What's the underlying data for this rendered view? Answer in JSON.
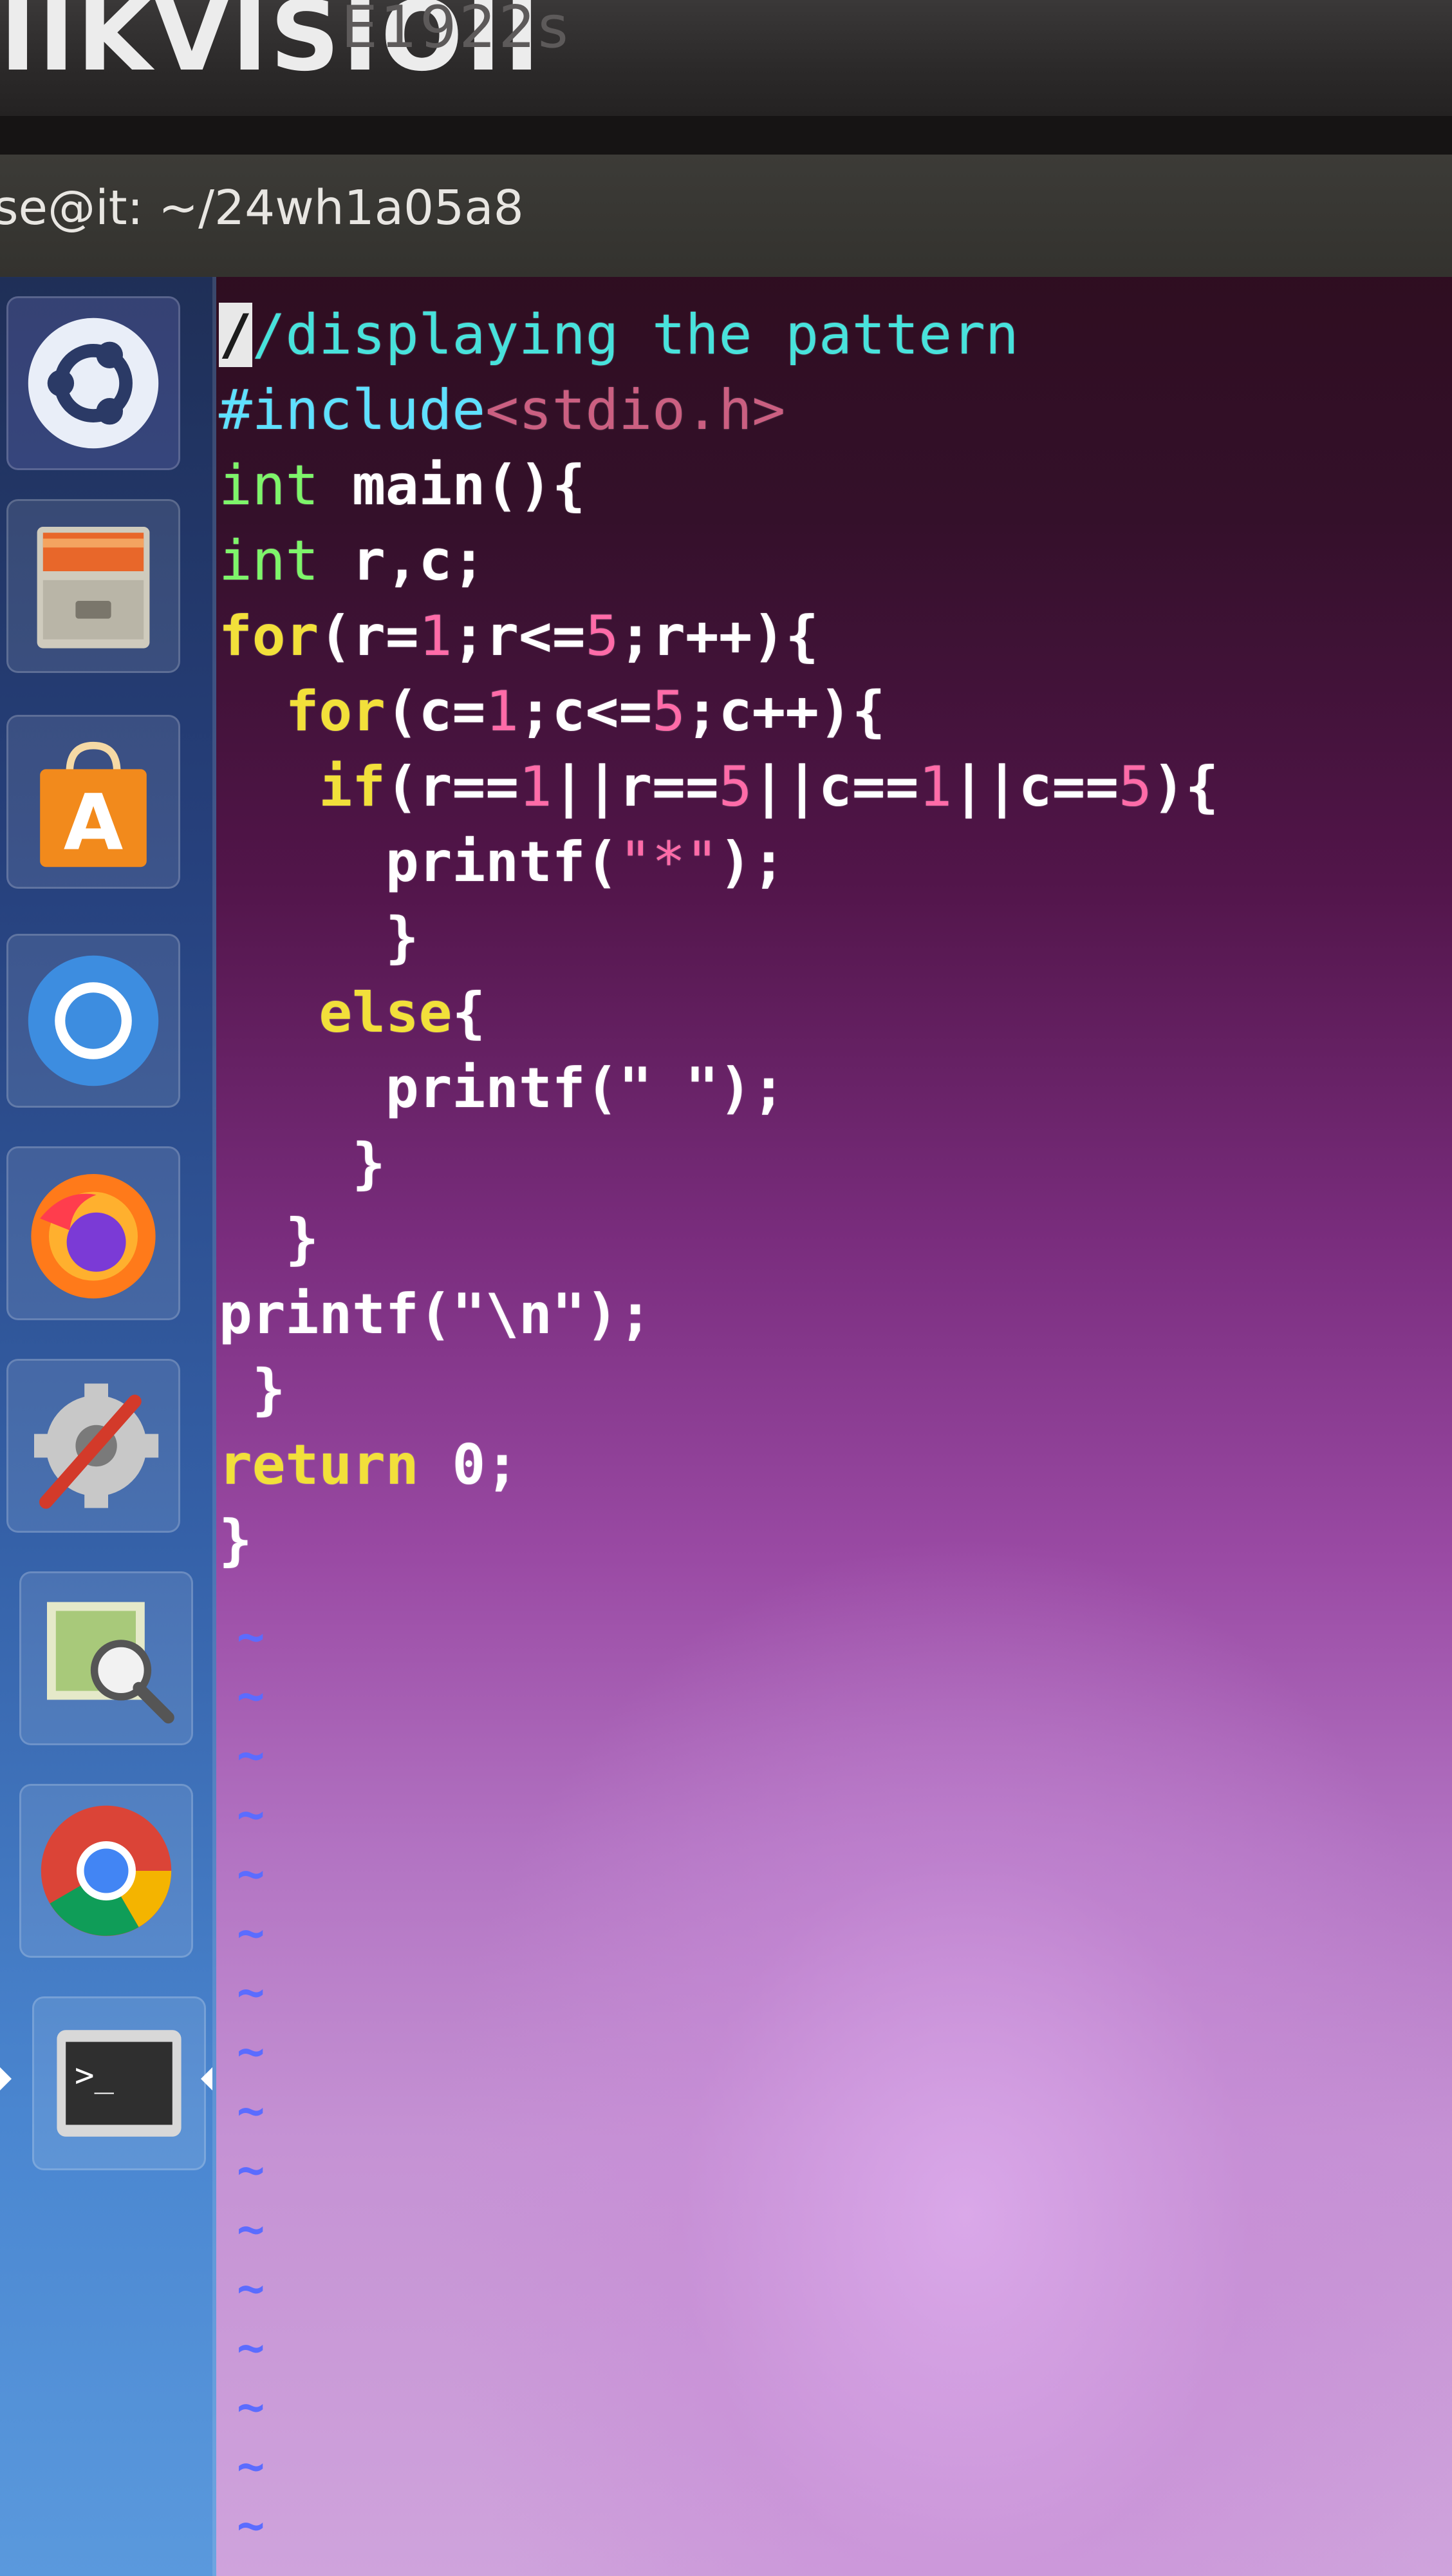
{
  "monitor": {
    "brand": "IIKVISIOII",
    "model": "E1922s"
  },
  "window": {
    "title": "se@it: ~/24wh1a05a8"
  },
  "launcher": {
    "items": [
      {
        "name": "dash",
        "icon": "ubuntu-logo-icon"
      },
      {
        "name": "files",
        "icon": "file-cabinet-icon"
      },
      {
        "name": "software",
        "icon": "shopping-bag-icon"
      },
      {
        "name": "chromium",
        "icon": "chromium-icon"
      },
      {
        "name": "firefox",
        "icon": "firefox-icon"
      },
      {
        "name": "system-settings",
        "icon": "settings-wrench-icon"
      },
      {
        "name": "image-viewer",
        "icon": "image-magnifier-icon"
      },
      {
        "name": "chrome",
        "icon": "chrome-icon"
      },
      {
        "name": "terminal",
        "icon": "terminal-icon"
      }
    ]
  },
  "editor": {
    "cursor_char": "/",
    "lines": [
      [
        {
          "t": "/displaying the pattern",
          "c": "comment"
        }
      ],
      [
        {
          "t": "#include",
          "c": "pre"
        },
        {
          "t": "<stdio.h>",
          "c": "inc"
        }
      ],
      [
        {
          "t": "int",
          "c": "type"
        },
        {
          "t": " main(){",
          "c": "plain"
        }
      ],
      [
        {
          "t": "int",
          "c": "type"
        },
        {
          "t": " r,c;",
          "c": "plain"
        }
      ],
      [
        {
          "t": "for",
          "c": "kw"
        },
        {
          "t": "(r=",
          "c": "plain"
        },
        {
          "t": "1",
          "c": "num"
        },
        {
          "t": ";r<=",
          "c": "plain"
        },
        {
          "t": "5",
          "c": "num"
        },
        {
          "t": ";r++){",
          "c": "plain"
        }
      ],
      [
        {
          "t": "  ",
          "c": "plain"
        },
        {
          "t": "for",
          "c": "kw"
        },
        {
          "t": "(c=",
          "c": "plain"
        },
        {
          "t": "1",
          "c": "num"
        },
        {
          "t": ";c<=",
          "c": "plain"
        },
        {
          "t": "5",
          "c": "num"
        },
        {
          "t": ";c++){",
          "c": "plain"
        }
      ],
      [
        {
          "t": "   ",
          "c": "plain"
        },
        {
          "t": "if",
          "c": "kw"
        },
        {
          "t": "(r==",
          "c": "plain"
        },
        {
          "t": "1",
          "c": "num"
        },
        {
          "t": "||r==",
          "c": "plain"
        },
        {
          "t": "5",
          "c": "num"
        },
        {
          "t": "||c==",
          "c": "plain"
        },
        {
          "t": "1",
          "c": "num"
        },
        {
          "t": "||c==",
          "c": "plain"
        },
        {
          "t": "5",
          "c": "num"
        },
        {
          "t": "){",
          "c": "plain"
        }
      ],
      [
        {
          "t": "     printf(",
          "c": "plain"
        },
        {
          "t": "\"*\"",
          "c": "str"
        },
        {
          "t": ");",
          "c": "plain"
        }
      ],
      [
        {
          "t": "     }",
          "c": "plain"
        }
      ],
      [
        {
          "t": "   ",
          "c": "plain"
        },
        {
          "t": "else",
          "c": "kw"
        },
        {
          "t": "{",
          "c": "plain"
        }
      ],
      [
        {
          "t": "     printf(\" \");",
          "c": "plain"
        }
      ],
      [
        {
          "t": "    }",
          "c": "plain"
        }
      ],
      [
        {
          "t": "  }",
          "c": "plain"
        }
      ],
      [
        {
          "t": "printf(\"\\n\");",
          "c": "plain"
        }
      ],
      [
        {
          "t": " }",
          "c": "plain"
        }
      ],
      [
        {
          "t": "return",
          "c": "kw"
        },
        {
          "t": " 0;",
          "c": "plain"
        }
      ],
      [
        {
          "t": "}",
          "c": "plain"
        }
      ]
    ],
    "tilde_char": "~",
    "tilde_count": 17
  }
}
